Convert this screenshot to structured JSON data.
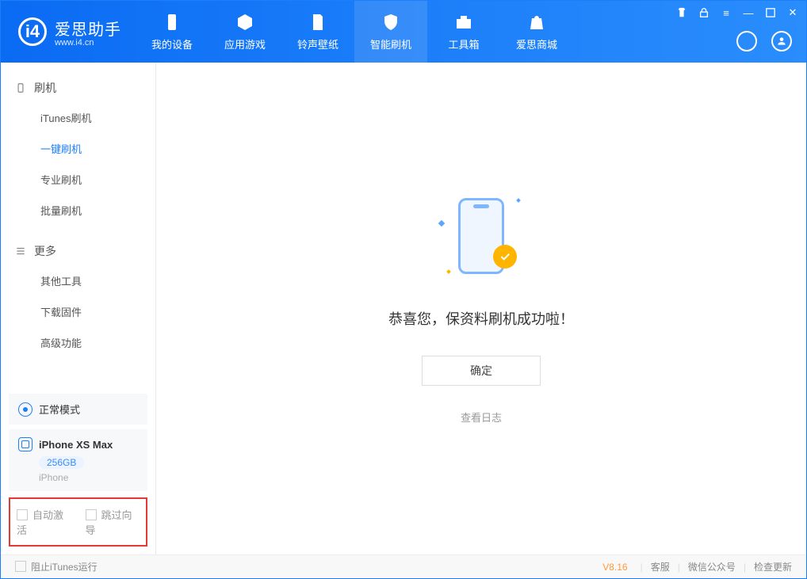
{
  "app": {
    "title": "爱思助手",
    "subtitle": "www.i4.cn"
  },
  "nav": {
    "items": [
      {
        "label": "我的设备"
      },
      {
        "label": "应用游戏"
      },
      {
        "label": "铃声壁纸"
      },
      {
        "label": "智能刷机"
      },
      {
        "label": "工具箱"
      },
      {
        "label": "爱思商城"
      }
    ],
    "active_index": 3
  },
  "sidebar": {
    "sections": [
      {
        "title": "刷机",
        "items": [
          {
            "label": "iTunes刷机"
          },
          {
            "label": "一键刷机"
          },
          {
            "label": "专业刷机"
          },
          {
            "label": "批量刷机"
          }
        ],
        "active_index": 1
      },
      {
        "title": "更多",
        "items": [
          {
            "label": "其他工具"
          },
          {
            "label": "下载固件"
          },
          {
            "label": "高级功能"
          }
        ]
      }
    ],
    "mode": {
      "label": "正常模式"
    },
    "device": {
      "name": "iPhone XS Max",
      "storage": "256GB",
      "type": "iPhone"
    },
    "options": {
      "auto_activate_label": "自动激活",
      "skip_guide_label": "跳过向导",
      "auto_activate_checked": false,
      "skip_guide_checked": false
    }
  },
  "main": {
    "success_message": "恭喜您，保资料刷机成功啦！",
    "ok_button": "确定",
    "view_log": "查看日志"
  },
  "footer": {
    "block_itunes_label": "阻止iTunes运行",
    "block_itunes_checked": false,
    "version": "V8.16",
    "links": [
      "客服",
      "微信公众号",
      "检查更新"
    ]
  },
  "colors": {
    "accent": "#1c7ef9",
    "highlight_border": "#e53935",
    "warn": "#ffb400"
  }
}
